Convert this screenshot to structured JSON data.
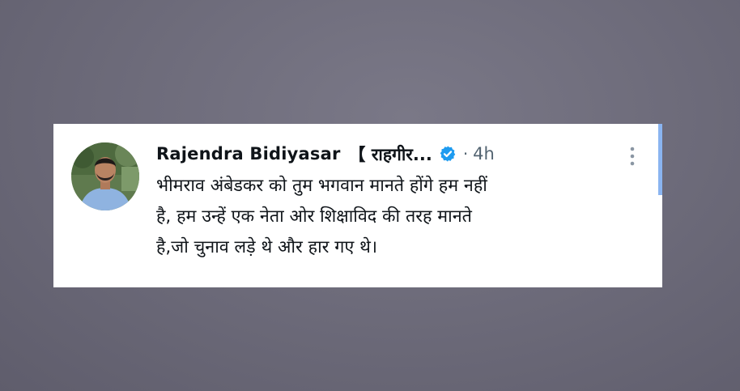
{
  "tweet": {
    "author_name": "Rajendra Bidiyasar",
    "author_handle": "【 राहगीर...",
    "separator": "·",
    "timestamp": "4h",
    "text_lines": [
      "भीमराव अंबेडकर को तुम भगवान मानते होंगे हम नहीं",
      "है, हम उन्हें एक नेता ओर शिक्षाविद की तरह मानते",
      "है,जो चुनाव लड़े थे और हार गए थे।"
    ]
  },
  "icons": {
    "verified": "verified-badge-icon",
    "more": "more-vertical-icon"
  },
  "colors": {
    "background": "#6e6c7b",
    "card": "#ffffff",
    "text": "#0f1419",
    "muted": "#536471",
    "verified": "#1d9bf0"
  }
}
